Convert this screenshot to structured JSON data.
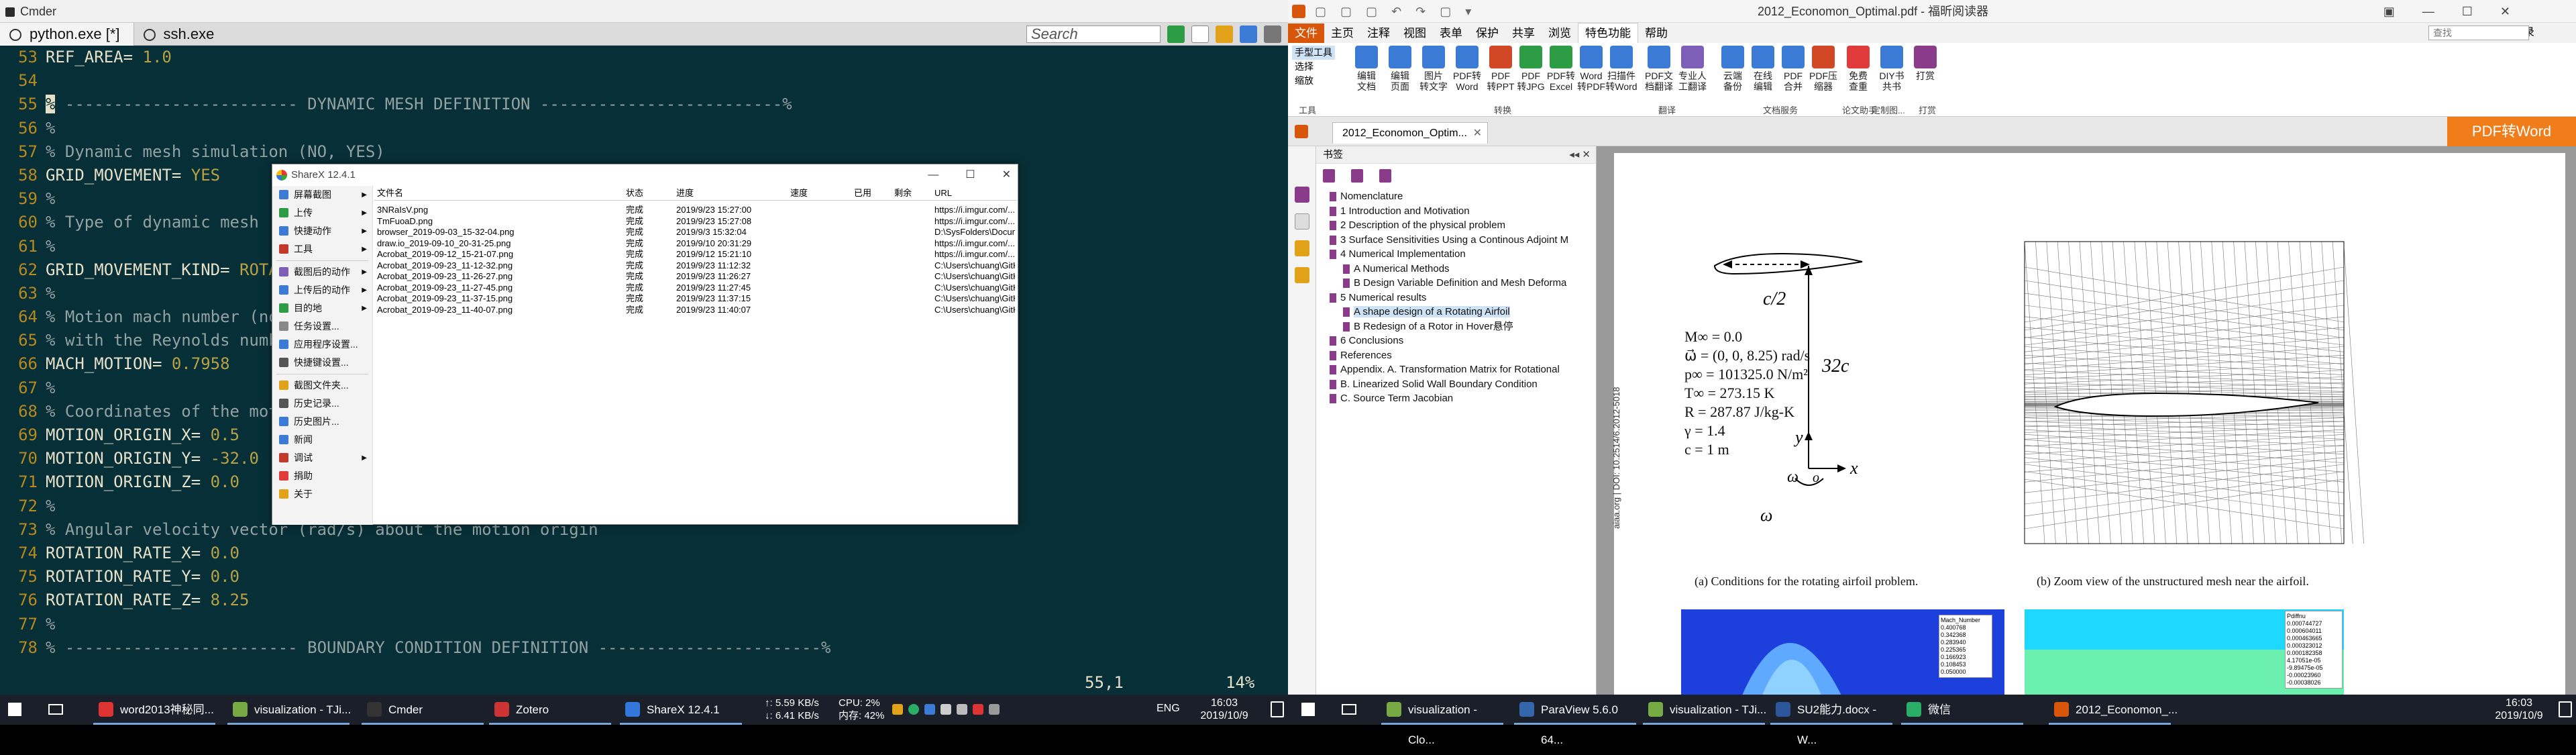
{
  "cmder": {
    "title": "Cmder",
    "tabs": [
      {
        "label": "python.exe [*]"
      },
      {
        "label": "ssh.exe"
      }
    ],
    "search_placeholder": "Search",
    "lines": [
      {
        "n": "53",
        "key": "REF_AREA",
        "eq": "= ",
        "val": "1.0",
        "type": "kv"
      },
      {
        "n": "54",
        "text": "",
        "type": "plain"
      },
      {
        "n": "55",
        "text": "% ------------------------ DYNAMIC MESH DEFINITION -------------------------%",
        "type": "comment_cursor"
      },
      {
        "n": "56",
        "text": "%",
        "type": "comment"
      },
      {
        "n": "57",
        "text": "% Dynamic mesh simulation (NO, YES)",
        "type": "comment"
      },
      {
        "n": "58",
        "key": "GRID_MOVEMENT",
        "eq": "= ",
        "val": "YES",
        "type": "kv"
      },
      {
        "n": "59",
        "text": "%",
        "type": "comment"
      },
      {
        "n": "60",
        "text": "% Type of dynamic mesh",
        "type": "comment"
      },
      {
        "n": "61",
        "text": "%",
        "type": "comment"
      },
      {
        "n": "62",
        "key": "GRID_MOVEMENT_KIND",
        "eq": "= ",
        "val": "ROTATING_FRAME",
        "type": "kv"
      },
      {
        "n": "63",
        "text": "%",
        "type": "comment"
      },
      {
        "n": "64",
        "text": "% Motion mach number (non-dimensional). Used for initializing a viscous flow",
        "type": "comment"
      },
      {
        "n": "65",
        "text": "% with the Reynolds number and for computing force coeffs. with dynamic meshes.",
        "type": "comment"
      },
      {
        "n": "66",
        "key": "MACH_MOTION",
        "eq": "= ",
        "val": "0.7958",
        "type": "kv"
      },
      {
        "n": "67",
        "text": "%",
        "type": "comment"
      },
      {
        "n": "68",
        "text": "% Coordinates of the motion origin",
        "type": "comment"
      },
      {
        "n": "69",
        "key": "MOTION_ORIGIN_X",
        "eq": "= ",
        "val": "0.5",
        "type": "kv"
      },
      {
        "n": "70",
        "key": "MOTION_ORIGIN_Y",
        "eq": "= ",
        "val": "-32.0",
        "type": "kv"
      },
      {
        "n": "71",
        "key": "MOTION_ORIGIN_Z",
        "eq": "= ",
        "val": "0.0",
        "type": "kv"
      },
      {
        "n": "72",
        "text": "%",
        "type": "comment"
      },
      {
        "n": "73",
        "text": "% Angular velocity vector (rad/s) about the motion origin",
        "type": "comment"
      },
      {
        "n": "74",
        "key": "ROTATION_RATE_X",
        "eq": "= ",
        "val": "0.0",
        "type": "kv"
      },
      {
        "n": "75",
        "key": "ROTATION_RATE_Y",
        "eq": "= ",
        "val": "0.0",
        "type": "kv"
      },
      {
        "n": "76",
        "key": "ROTATION_RATE_Z",
        "eq": "= ",
        "val": "8.25",
        "type": "kv"
      },
      {
        "n": "77",
        "text": "%",
        "type": "comment"
      },
      {
        "n": "78",
        "text": "% ------------------------ BOUNDARY CONDITION DEFINITION -----------------------%",
        "type": "comment"
      }
    ],
    "status_pos": "55,1",
    "status_pct": "14%"
  },
  "sharex": {
    "title": "ShareX 12.4.1",
    "menu": [
      {
        "label": "屏幕截图",
        "arrow": true,
        "color": "#3b7bd6"
      },
      {
        "label": "上传",
        "arrow": true,
        "color": "#2e9c44"
      },
      {
        "label": "快捷动作",
        "arrow": true,
        "color": "#3b7bd6"
      },
      {
        "label": "工具",
        "arrow": true,
        "color": "#c0392b"
      },
      {
        "sep": true
      },
      {
        "label": "截图后的动作",
        "arrow": true,
        "color": "#7d5fb8"
      },
      {
        "label": "上传后的动作",
        "arrow": true,
        "color": "#3b7bd6"
      },
      {
        "label": "目的地",
        "arrow": true,
        "color": "#2e9c44"
      },
      {
        "label": "任务设置...",
        "arrow": false,
        "color": "#888888"
      },
      {
        "label": "应用程序设置...",
        "arrow": false,
        "color": "#3b7bd6"
      },
      {
        "label": "快捷键设置...",
        "arrow": false,
        "color": "#555555"
      },
      {
        "sep": true
      },
      {
        "label": "截图文件夹...",
        "arrow": false,
        "color": "#e1a21a"
      },
      {
        "label": "历史记录...",
        "arrow": false,
        "color": "#555555"
      },
      {
        "label": "历史图片...",
        "arrow": false,
        "color": "#3b7bd6"
      },
      {
        "label": "新闻",
        "arrow": false,
        "color": "#3b7bd6"
      },
      {
        "label": "调试",
        "arrow": true,
        "color": "#c0392b"
      },
      {
        "label": "捐助",
        "arrow": false,
        "color": "#e03a3a"
      },
      {
        "label": "关于",
        "arrow": false,
        "color": "#e1a21a"
      }
    ],
    "headers": [
      "文件名",
      "状态",
      "进度",
      "速度",
      "已用",
      "剩余",
      "URL"
    ],
    "rows": [
      [
        "3NRaIsV.png",
        "完成",
        "2019/9/23 15:27:00",
        "",
        "",
        "",
        "https://i.imgur.com/..."
      ],
      [
        "TmFuoaD.png",
        "完成",
        "2019/9/23 15:27:08",
        "",
        "",
        "",
        "https://i.imgur.com/..."
      ],
      [
        "browser_2019-09-03_15-32-04.png",
        "完成",
        "2019/9/3 15:32:04",
        "",
        "",
        "",
        "D:\\SysFolders\\Docume..."
      ],
      [
        "draw.io_2019-09-10_20-31-25.png",
        "完成",
        "2019/9/10 20:31:29",
        "",
        "",
        "",
        "https://i.imgur.com/..."
      ],
      [
        "Acrobat_2019-09-12_15-21-07.png",
        "完成",
        "2019/9/12 15:21:10",
        "",
        "",
        "",
        "https://i.imgur.com/..."
      ],
      [
        "Acrobat_2019-09-23_11-12-32.png",
        "完成",
        "2019/9/23 11:12:32",
        "",
        "",
        "",
        "C:\\Users\\chuang\\GitH..."
      ],
      [
        "Acrobat_2019-09-23_11-26-27.png",
        "完成",
        "2019/9/23 11:26:27",
        "",
        "",
        "",
        "C:\\Users\\chuang\\GitH..."
      ],
      [
        "Acrobat_2019-09-23_11-27-45.png",
        "完成",
        "2019/9/23 11:27:45",
        "",
        "",
        "",
        "C:\\Users\\chuang\\GitH..."
      ],
      [
        "Acrobat_2019-09-23_11-37-15.png",
        "完成",
        "2019/9/23 11:37:15",
        "",
        "",
        "",
        "C:\\Users\\chuang\\GitH..."
      ],
      [
        "Acrobat_2019-09-23_11-40-07.png",
        "完成",
        "2019/9/23 11:40:07",
        "",
        "",
        "",
        "C:\\Users\\chuang\\GitH..."
      ]
    ]
  },
  "taskbar_left": {
    "items": [
      {
        "label": "word2013神秘同...",
        "color": "#d33"
      },
      {
        "label": "visualization - TJi...",
        "color": "#7a4"
      },
      {
        "label": "Cmder",
        "color": "#333"
      },
      {
        "label": "Zotero",
        "color": "#c33"
      },
      {
        "label": "ShareX 12.4.1",
        "color": "#37d"
      }
    ],
    "net_up": "↑: 5.59 KB/s",
    "net_down": "↓: 6.41 KB/s",
    "cpu": "CPU: 2%",
    "mem": "内存: 42%",
    "ime": "ENG",
    "time": "16:03",
    "date": "2019/10/9"
  },
  "pdf": {
    "title": "2012_Economon_Optimal.pdf - 福昕阅读器",
    "login": "未登录",
    "search_placeholder": "查找",
    "menu": [
      "文件",
      "主页",
      "注释",
      "视图",
      "表单",
      "保护",
      "共享",
      "浏览",
      "特色功能",
      "帮助"
    ],
    "ribbon": [
      {
        "label": "编辑\n文档",
        "color": "#3b7bd6"
      },
      {
        "label": "编辑\n页面",
        "color": "#3b7bd6"
      },
      {
        "label": "图片\n转文字",
        "color": "#3b7bd6"
      },
      {
        "label": "PDF转\nWord",
        "color": "#3b7bd6"
      },
      {
        "label": "PDF\n转PPT",
        "color": "#d24726"
      },
      {
        "label": "PDF\n转JPG",
        "color": "#2e9c44"
      },
      {
        "label": "PDF转\nExcel",
        "color": "#2e9c44"
      },
      {
        "label": "Word\n转PDF",
        "color": "#3b7bd6"
      },
      {
        "label": "扫描件\n转Word",
        "color": "#3b7bd6"
      },
      {
        "label": "PDF文\n档翻译",
        "color": "#3b7bd6"
      },
      {
        "label": "专业人\n工翻译",
        "color": "#7d5fb8"
      },
      {
        "label": "云端\n备份",
        "color": "#3b7bd6"
      },
      {
        "label": "在线\n编辑",
        "color": "#3b7bd6"
      },
      {
        "label": "PDF\n合并",
        "color": "#3b7bd6"
      },
      {
        "label": "PDF压\n缩器",
        "color": "#d24726"
      },
      {
        "label": "免费\n查重",
        "color": "#e03a3a"
      },
      {
        "label": "DIY书\n共书",
        "color": "#3b7bd6"
      },
      {
        "label": "打赏",
        "color": "#8a3c8a"
      }
    ],
    "ribbon_groups": [
      "工具",
      "转换",
      "翻译",
      "文档服务",
      "论文助手",
      "定制图...",
      "打赏"
    ],
    "tools": [
      "手型工具",
      "选择",
      "缩放"
    ],
    "tab": "2012_Economon_Optim...",
    "to_word": "PDF转Word",
    "bookmark_title": "书签",
    "bookmarks": [
      {
        "t": "Nomenclature",
        "lvl": 0
      },
      {
        "t": "1 Introduction and Motivation",
        "lvl": 0
      },
      {
        "t": "2 Description of the physical problem",
        "lvl": 0
      },
      {
        "t": "3 Surface Sensitivities Using a Continous Adjoint M",
        "lvl": 0
      },
      {
        "t": "4 Numerical Implementation",
        "lvl": 0
      },
      {
        "t": "A Numerical Methods",
        "lvl": 1
      },
      {
        "t": "B Design Variable Definition and Mesh Deforma",
        "lvl": 1
      },
      {
        "t": "5 Numerical results",
        "lvl": 0
      },
      {
        "t": "A shape design of a Rotating Airfoil",
        "lvl": 1,
        "sel": true
      },
      {
        "t": "B Redesign of a Rotor in Hover悬停",
        "lvl": 1
      },
      {
        "t": "6 Conclusions",
        "lvl": 0
      },
      {
        "t": "References",
        "lvl": 0
      },
      {
        "t": "Appendix. A. Transformation Matrix for Rotational",
        "lvl": 0
      },
      {
        "t": "B. Linearized Solid Wall Boundary Condition",
        "lvl": 0
      },
      {
        "t": "C. Source Term Jacobian",
        "lvl": 0
      }
    ],
    "doi": "aiaa.org | DOI: 10.2514/6.2012-5018",
    "labels": {
      "c2": "c/2",
      "c32": "32c",
      "y": "y",
      "x": "x",
      "o": "o",
      "omega": "ω",
      "vec_omega": "ω"
    },
    "equations": [
      "M∞ = 0.0",
      "ω⃗ = (0, 0, 8.25) rad/s",
      "p∞ = 101325.0 N/m²",
      "T∞ = 273.15 K",
      "R = 287.87 J/kg-K",
      "γ = 1.4",
      "c = 1 m"
    ],
    "caption_a": "(a) Conditions for the rotating airfoil problem.",
    "caption_b": "(b) Zoom view of the unstructured mesh near the airfoil.",
    "legend_a_title": "Mach_Number",
    "legend_a": [
      "0.400768",
      "0.342368",
      "0.283940",
      "0.225365",
      "0.166923",
      "0.108453",
      "0.050000"
    ],
    "legend_b_title": "Pdiffnu",
    "legend_b": [
      "0.000744727",
      "0.000604011",
      "0.000463665",
      "0.000323012",
      "0.000182358",
      "4.17051e-05",
      "-9.89475e-05",
      "-0.00023960",
      "-0.00038026"
    ]
  },
  "taskbar_right": {
    "items": [
      {
        "label": "visualization - Clo...",
        "color": "#7a4"
      },
      {
        "label": "ParaView 5.6.0 64...",
        "color": "#36a"
      },
      {
        "label": "visualization - TJi...",
        "color": "#7a4"
      },
      {
        "label": "SU2能力.docx - W...",
        "color": "#2b579a"
      },
      {
        "label": "微信",
        "color": "#2aae67"
      },
      {
        "label": "2012_Economon_...",
        "color": "#d8560a"
      }
    ],
    "time": "16:03",
    "date": "2019/10/9"
  }
}
